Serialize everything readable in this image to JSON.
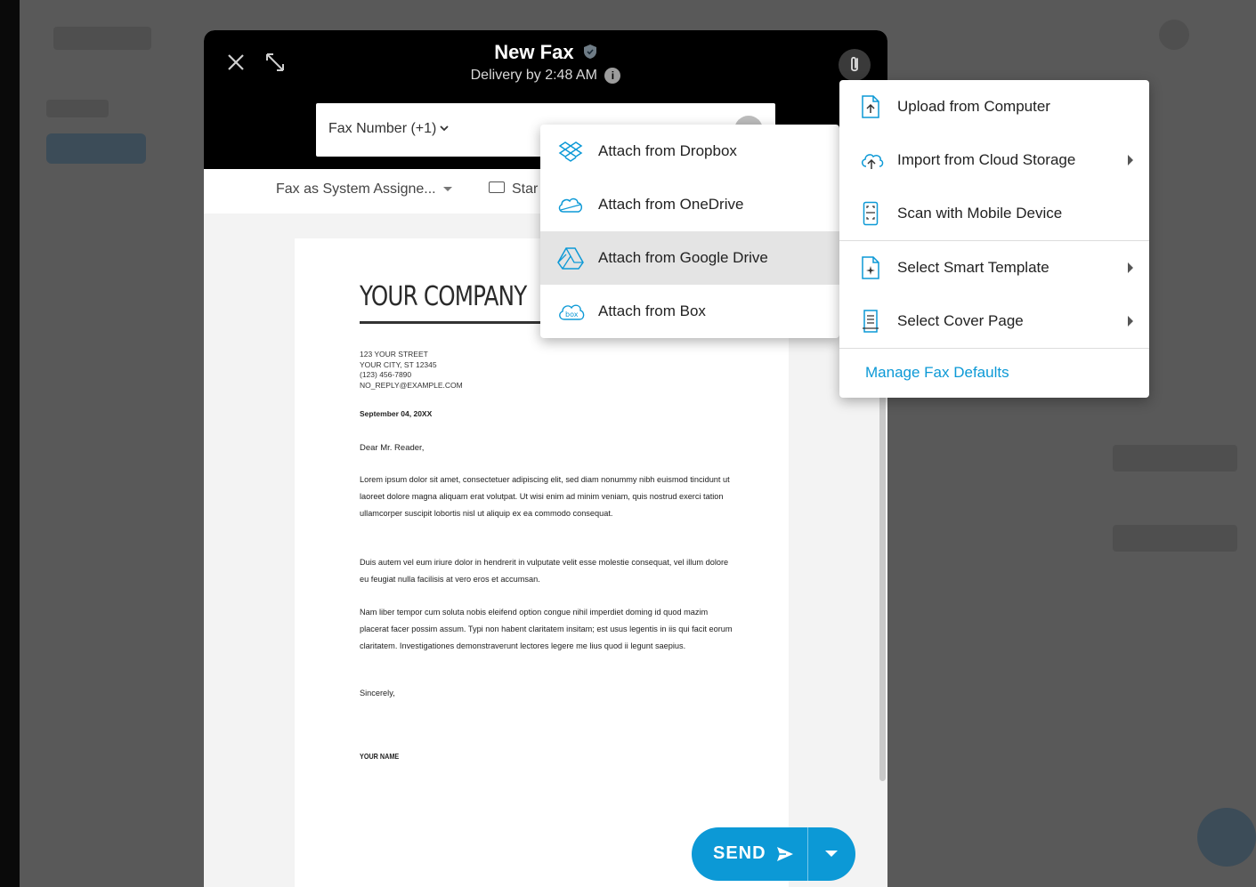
{
  "modal": {
    "title": "New Fax",
    "subtitle": "Delivery by 2:48 AM",
    "fax_number_prefix": "Fax Number (+1)",
    "caller_id": "Fax as System Assigne...",
    "resolution_partial": "Star"
  },
  "document": {
    "company": "YOUR COMPANY",
    "address_lines": [
      "123 YOUR STREET",
      "YOUR CITY, ST 12345",
      "(123) 456-7890",
      "NO_REPLY@EXAMPLE.COM"
    ],
    "date": "September 04, 20XX",
    "greeting": "Dear Mr. Reader,",
    "paragraph1": "Lorem ipsum dolor sit amet, consectetuer adipiscing elit, sed diam nonummy nibh euismod tincidunt ut laoreet dolore magna aliquam erat volutpat. Ut wisi enim ad minim veniam, quis nostrud exerci tation ullamcorper suscipit lobortis nisl ut aliquip ex ea commodo consequat.",
    "paragraph2": "Duis autem vel eum iriure dolor in hendrerit in vulputate velit esse molestie consequat, vel illum dolore eu feugiat nulla facilisis at vero eros et accumsan.",
    "paragraph3": "Nam liber tempor cum soluta nobis eleifend option congue nihil imperdiet doming id quod mazim placerat facer possim assum. Typi non habent claritatem insitam; est usus legentis in iis qui facit eorum claritatem. Investigationes demonstraverunt lectores legere me lius quod ii legunt saepius.",
    "closing": "Sincerely,",
    "signature": "YOUR NAME"
  },
  "send": {
    "label": "SEND"
  },
  "cloud_menu": {
    "items": [
      {
        "label": "Attach from Dropbox",
        "icon": "dropbox-icon"
      },
      {
        "label": "Attach from OneDrive",
        "icon": "onedrive-icon"
      },
      {
        "label": "Attach from Google Drive",
        "icon": "google-drive-icon"
      },
      {
        "label": "Attach from Box",
        "icon": "box-icon"
      }
    ]
  },
  "attach_menu": {
    "items": [
      {
        "label": "Upload from Computer",
        "icon": "upload-file-icon"
      },
      {
        "label": "Import from Cloud Storage",
        "icon": "cloud-upload-icon"
      },
      {
        "label": "Scan with Mobile Device",
        "icon": "mobile-scan-icon"
      },
      {
        "label": "Select Smart Template",
        "icon": "smart-template-icon"
      },
      {
        "label": "Select Cover Page",
        "icon": "cover-page-icon"
      }
    ],
    "manage_label": "Manage Fax Defaults"
  },
  "colors": {
    "accent": "#0c99d6",
    "header": "#000000",
    "highlight": "#e4e4e4"
  }
}
